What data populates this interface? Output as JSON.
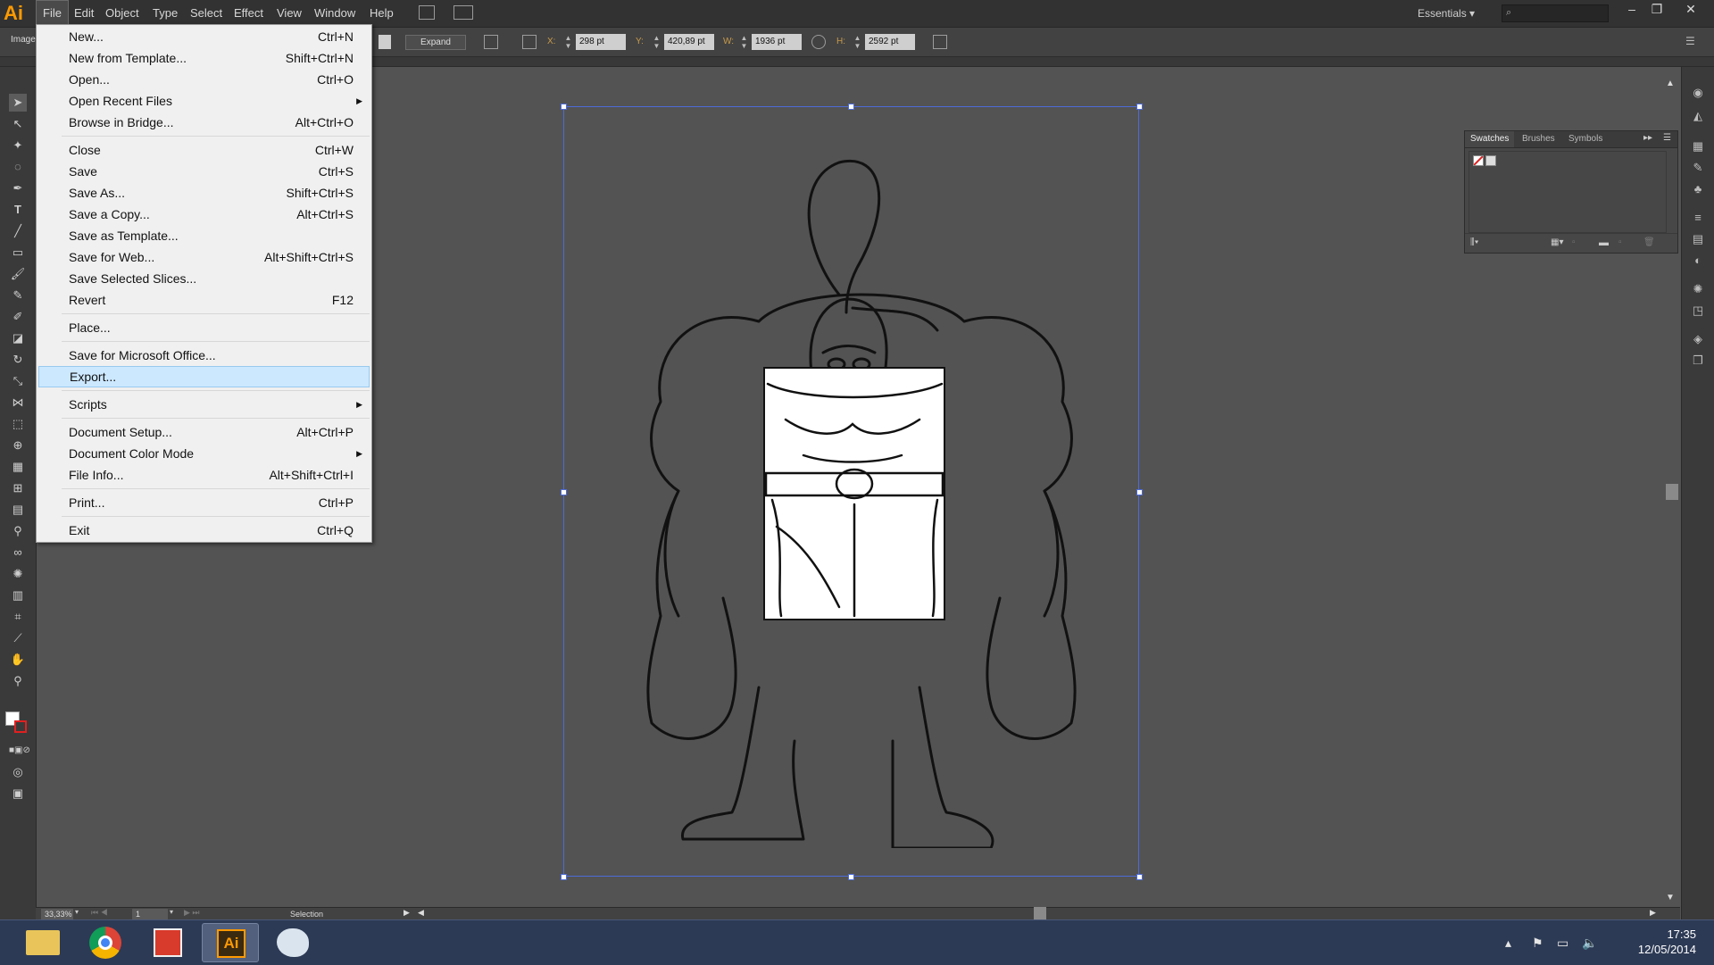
{
  "app": {
    "logo": "Ai"
  },
  "menubar": {
    "items": [
      "File",
      "Edit",
      "Object",
      "Type",
      "Select",
      "Effect",
      "View",
      "Window",
      "Help"
    ],
    "workspace": "Essentials",
    "window_controls": [
      "minimize-icon",
      "restore-icon",
      "close-icon"
    ]
  },
  "controlbar": {
    "context_label": "Image",
    "expand_label": "Expand",
    "x_label": "X:",
    "x_value": "298 pt",
    "y_label": "Y:",
    "y_value": "420,89 pt",
    "w_label": "W:",
    "w_value": "1936 pt",
    "h_label": "H:",
    "h_value": "2592 pt"
  },
  "file_menu": {
    "items": [
      {
        "label": "New...",
        "shortcut": "Ctrl+N"
      },
      {
        "label": "New from Template...",
        "shortcut": "Shift+Ctrl+N"
      },
      {
        "label": "Open...",
        "shortcut": "Ctrl+O"
      },
      {
        "label": "Open Recent Files",
        "shortcut": "",
        "submenu": true
      },
      {
        "label": "Browse in Bridge...",
        "shortcut": "Alt+Ctrl+O"
      },
      {
        "label": "Close",
        "shortcut": "Ctrl+W"
      },
      {
        "label": "Save",
        "shortcut": "Ctrl+S"
      },
      {
        "label": "Save As...",
        "shortcut": "Shift+Ctrl+S"
      },
      {
        "label": "Save a Copy...",
        "shortcut": "Alt+Ctrl+S"
      },
      {
        "label": "Save as Template...",
        "shortcut": ""
      },
      {
        "label": "Save for Web...",
        "shortcut": "Alt+Shift+Ctrl+S"
      },
      {
        "label": "Save Selected Slices...",
        "shortcut": ""
      },
      {
        "label": "Revert",
        "shortcut": "F12"
      },
      {
        "label": "Place...",
        "shortcut": ""
      },
      {
        "label": "Save for Microsoft Office...",
        "shortcut": ""
      },
      {
        "label": "Export...",
        "shortcut": "",
        "highlighted": true
      },
      {
        "label": "Scripts",
        "shortcut": "",
        "submenu": true
      },
      {
        "label": "Document Setup...",
        "shortcut": "Alt+Ctrl+P"
      },
      {
        "label": "Document Color Mode",
        "shortcut": "",
        "submenu": true
      },
      {
        "label": "File Info...",
        "shortcut": "Alt+Shift+Ctrl+I"
      },
      {
        "label": "Print...",
        "shortcut": "Ctrl+P"
      },
      {
        "label": "Exit",
        "shortcut": "Ctrl+Q"
      }
    ]
  },
  "swatches_panel": {
    "tabs": [
      "Swatches",
      "Brushes",
      "Symbols"
    ],
    "active_tab": "Swatches"
  },
  "statusbar": {
    "zoom": "33,33%",
    "artboard": "1",
    "tool": "Selection"
  },
  "taskbar": {
    "apps": [
      "file-explorer-icon",
      "chrome-icon",
      "acrobat-icon",
      "illustrator-icon",
      "paint-icon"
    ],
    "active_app": "illustrator-icon",
    "illustrator_label": "Ai",
    "time": "17:35",
    "date": "12/05/2014"
  },
  "colors": {
    "canvas": "#535353",
    "panel": "#3a3a3a",
    "selection": "#4d6bd8",
    "menu_highlight": "#cce8ff",
    "taskbar": "#2d3a55",
    "ai_orange": "#ff9a00"
  }
}
